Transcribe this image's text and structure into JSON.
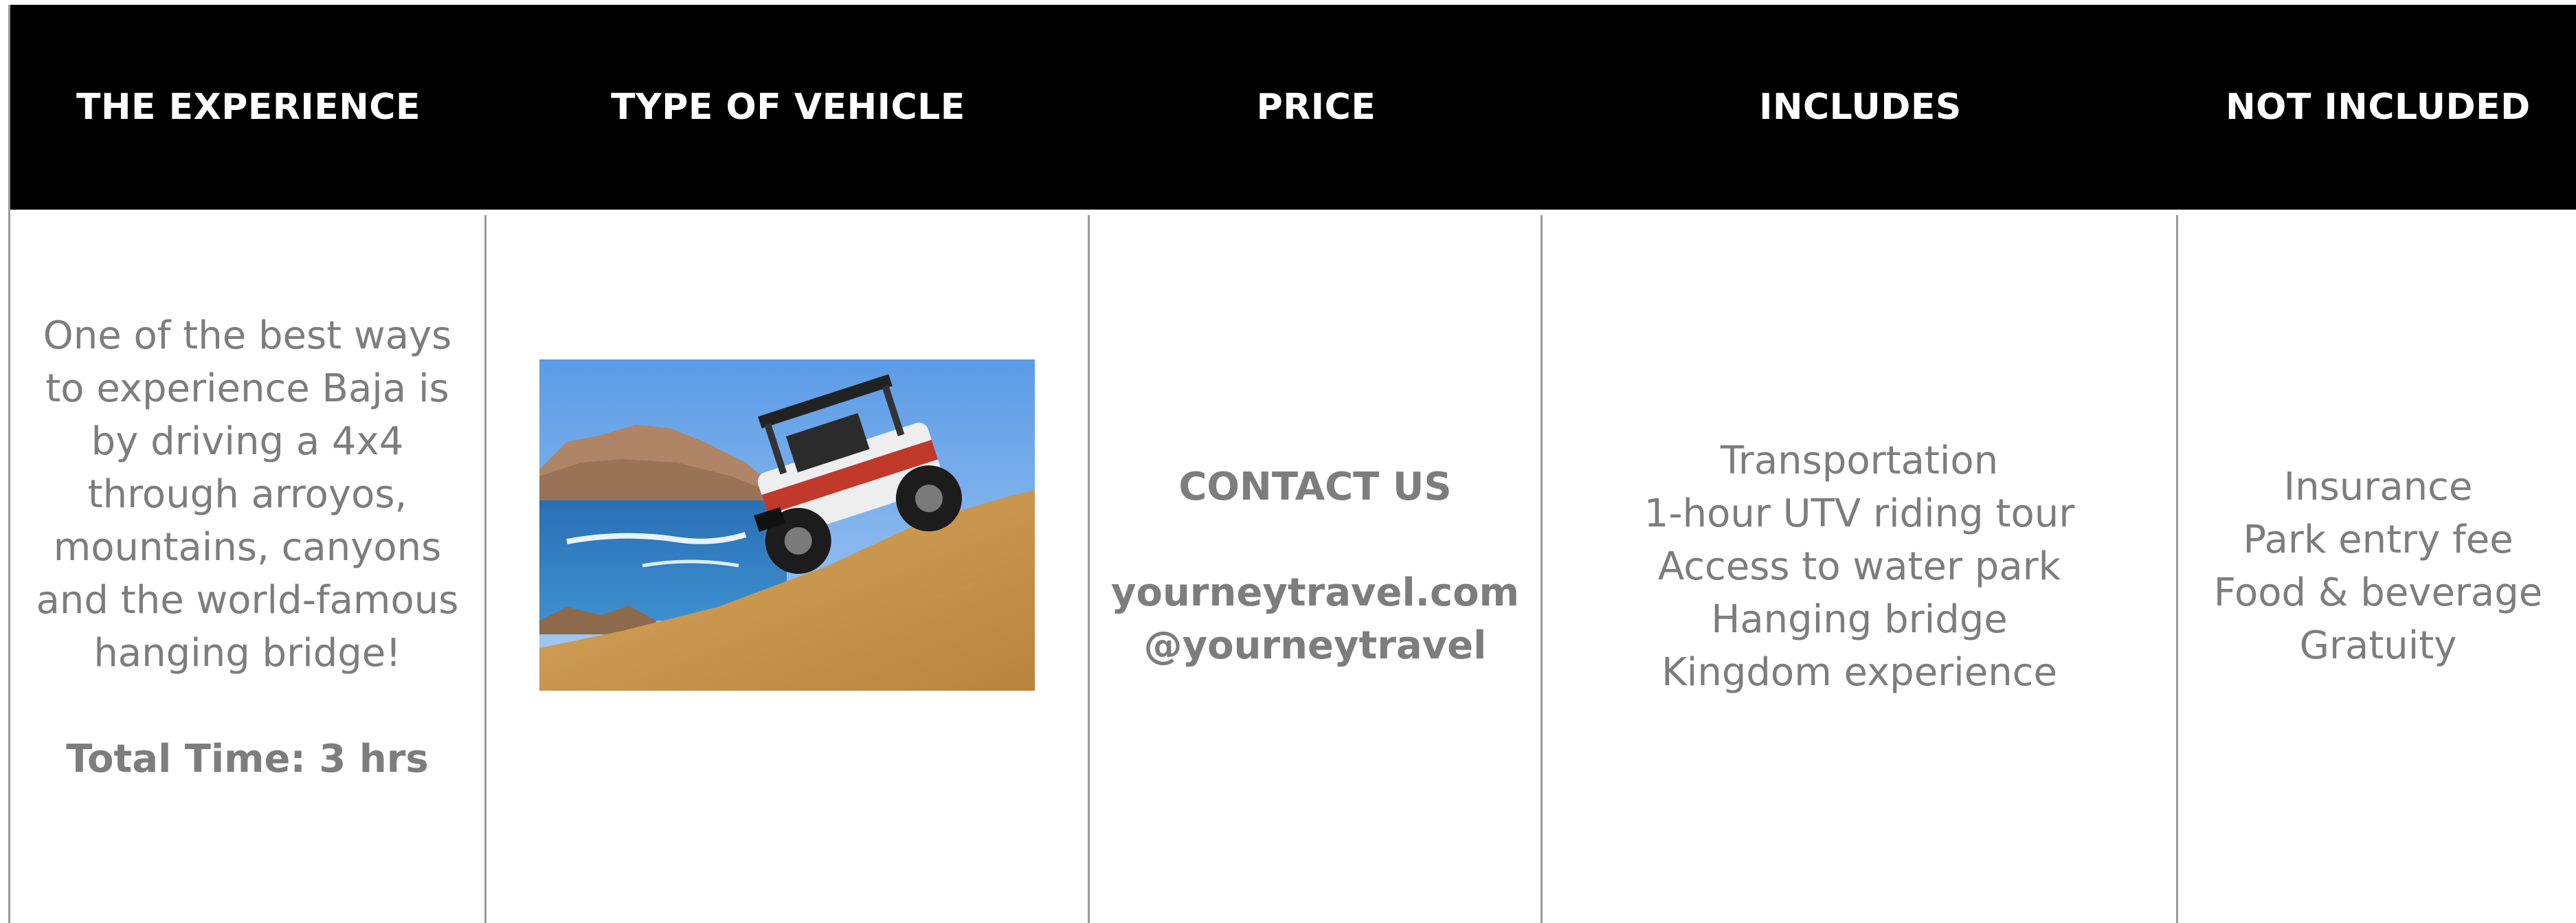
{
  "header": {
    "col1": "THE EXPERIENCE",
    "col2": "TYPE OF VEHICLE",
    "col3": "PRICE",
    "col4": "INCLUDES",
    "col5": "NOT INCLUDED"
  },
  "experience": {
    "description_lines": [
      "One of the best ways",
      "to experience Baja is",
      "by driving a 4x4",
      "through arroyos,",
      "mountains, canyons",
      "and the world-famous",
      "hanging bridge!"
    ],
    "total_time": "Total Time: 3 hrs"
  },
  "vehicle": {
    "image_alt_icon": "utv-photo"
  },
  "price": {
    "contact": "CONTACT US",
    "website": "yourneytravel.com",
    "handle": "@yourneytravel"
  },
  "includes": {
    "items": [
      "Transportation",
      "1-hour UTV riding tour",
      "Access to water park",
      "Hanging bridge",
      "Kingdom experience"
    ]
  },
  "not_included": {
    "items": [
      "Insurance",
      "Park entry fee",
      "Food & beverage",
      "Gratuity"
    ]
  },
  "colors": {
    "header_bg": "#000000",
    "header_text": "#ffffff",
    "body_text": "#7d7d7d",
    "divider": "#9a9a9a"
  }
}
